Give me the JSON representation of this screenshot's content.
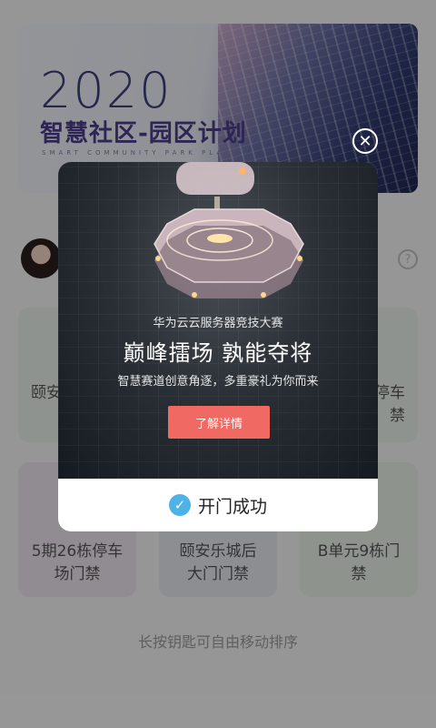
{
  "banner": {
    "year": "2020",
    "title": "智慧社区-园区计划",
    "subtitle": "SMART COMMUNITY PARK PLAN"
  },
  "help_icon": "?",
  "cards": [
    {
      "label": "颐安"
    },
    {
      "label": ""
    },
    {
      "label": "停车\n禁"
    },
    {
      "label": "5期26栋停车\n场门禁"
    },
    {
      "label": "颐安乐城后\n大门门禁"
    },
    {
      "label": "B单元9栋门\n禁"
    }
  ],
  "hint": "长按钥匙可自由移动排序",
  "modal": {
    "ad": {
      "sub1": "华为云云服务器竞技大赛",
      "headline": "巅峰擂场 孰能夺将",
      "sub2": "智慧赛道创意角逐，多重豪礼为你而来",
      "cta": "了解详情"
    },
    "status_text": "开门成功",
    "check_glyph": "✓",
    "close_glyph": "✕"
  },
  "colors": {
    "cta": "#f06a63",
    "check": "#4db3e6"
  }
}
